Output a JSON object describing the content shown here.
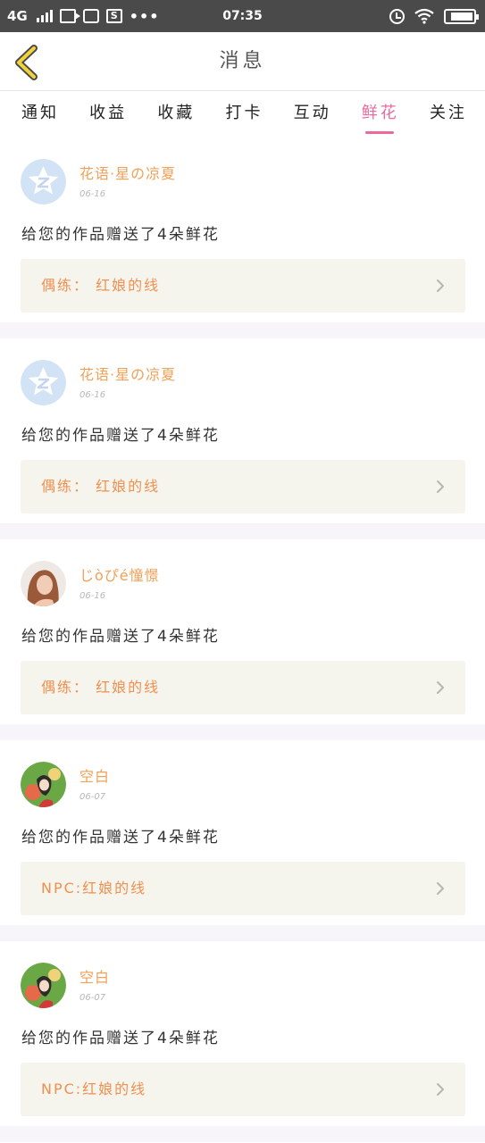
{
  "status_bar": {
    "network": "4G",
    "time": "07:35",
    "dots": "•••",
    "battery_level": 0.85
  },
  "header": {
    "back_icon": "chevron-left-icon",
    "title": "消息"
  },
  "tabs": [
    {
      "label": "通知",
      "active": false
    },
    {
      "label": "收益",
      "active": false
    },
    {
      "label": "收藏",
      "active": false
    },
    {
      "label": "打卡",
      "active": false
    },
    {
      "label": "互动",
      "active": false
    },
    {
      "label": "鲜花",
      "active": true
    },
    {
      "label": "关注",
      "active": false
    }
  ],
  "colors": {
    "accent": "#ea6a9f",
    "name": "#f0a057",
    "work_title": "#f09050",
    "status_bar": "#4a4a4a"
  },
  "messages": [
    {
      "avatar": "qq-default-avatar",
      "name": "花语·星の凉夏",
      "date": "06-16",
      "text": "给您的作品赠送了4朵鲜花",
      "work": "偶练： 红娘的线"
    },
    {
      "avatar": "qq-default-avatar",
      "name": "花语·星の凉夏",
      "date": "06-16",
      "text": "给您的作品赠送了4朵鲜花",
      "work": "偶练： 红娘的线"
    },
    {
      "avatar": "photo-avatar-girl",
      "name": "じòぴé憧憬",
      "date": "06-16",
      "text": "给您的作品赠送了4朵鲜花",
      "work": "偶练： 红娘的线"
    },
    {
      "avatar": "anime-avatar",
      "name": "空白",
      "date": "06-07",
      "text": "给您的作品赠送了4朵鲜花",
      "work": "NPC:红娘的线"
    },
    {
      "avatar": "anime-avatar",
      "name": "空白",
      "date": "06-07",
      "text": "给您的作品赠送了4朵鲜花",
      "work": "NPC:红娘的线"
    }
  ]
}
